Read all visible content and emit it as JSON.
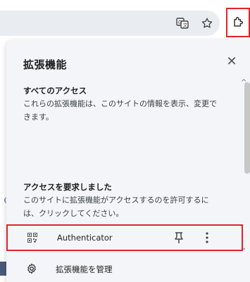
{
  "toolbar": {
    "translate_icon": "translate-icon",
    "bookmark_icon": "star-icon",
    "extensions_icon": "puzzle-icon"
  },
  "panel": {
    "title": "拡張機能",
    "close_icon": "close-icon",
    "sections": {
      "all_access": {
        "heading": "すべてのアクセス",
        "text": "これらの拡張機能は、このサイトの情報を表示、変更できます。"
      },
      "requested": {
        "heading": "アクセスを要求しました",
        "text": "このサイトに拡張機能がアクセスするのを許可するには、クリックしてください。"
      }
    },
    "extension": {
      "name": "Authenticator",
      "icon": "qr-code-icon",
      "pin_icon": "pin-icon",
      "more_icon": "more-vertical-icon"
    },
    "manage": {
      "label": "拡張機能を管理",
      "icon": "gear-icon"
    }
  },
  "colors": {
    "highlight": "#e0242b",
    "panel_bg": "#f3f5f8",
    "omnibox_bg": "#e9edf2"
  }
}
